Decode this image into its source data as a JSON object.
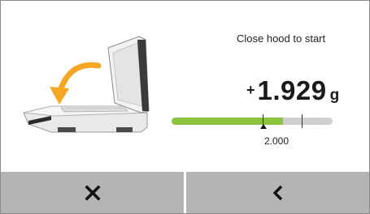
{
  "prompt": {
    "text": "Close hood to start"
  },
  "weight": {
    "sign": "+",
    "value": "1.929",
    "unit": "g"
  },
  "progress": {
    "fraction": 0.69
  },
  "target": {
    "value": "2.000"
  },
  "buttons": {
    "cancel_icon": "close-icon",
    "back_icon": "chevron-left-icon"
  },
  "colors": {
    "progress_fill": "#8cc43e",
    "progress_track": "#cfcfcf",
    "button_bg": "#b4b4b4",
    "arrow": "#f5a623"
  }
}
